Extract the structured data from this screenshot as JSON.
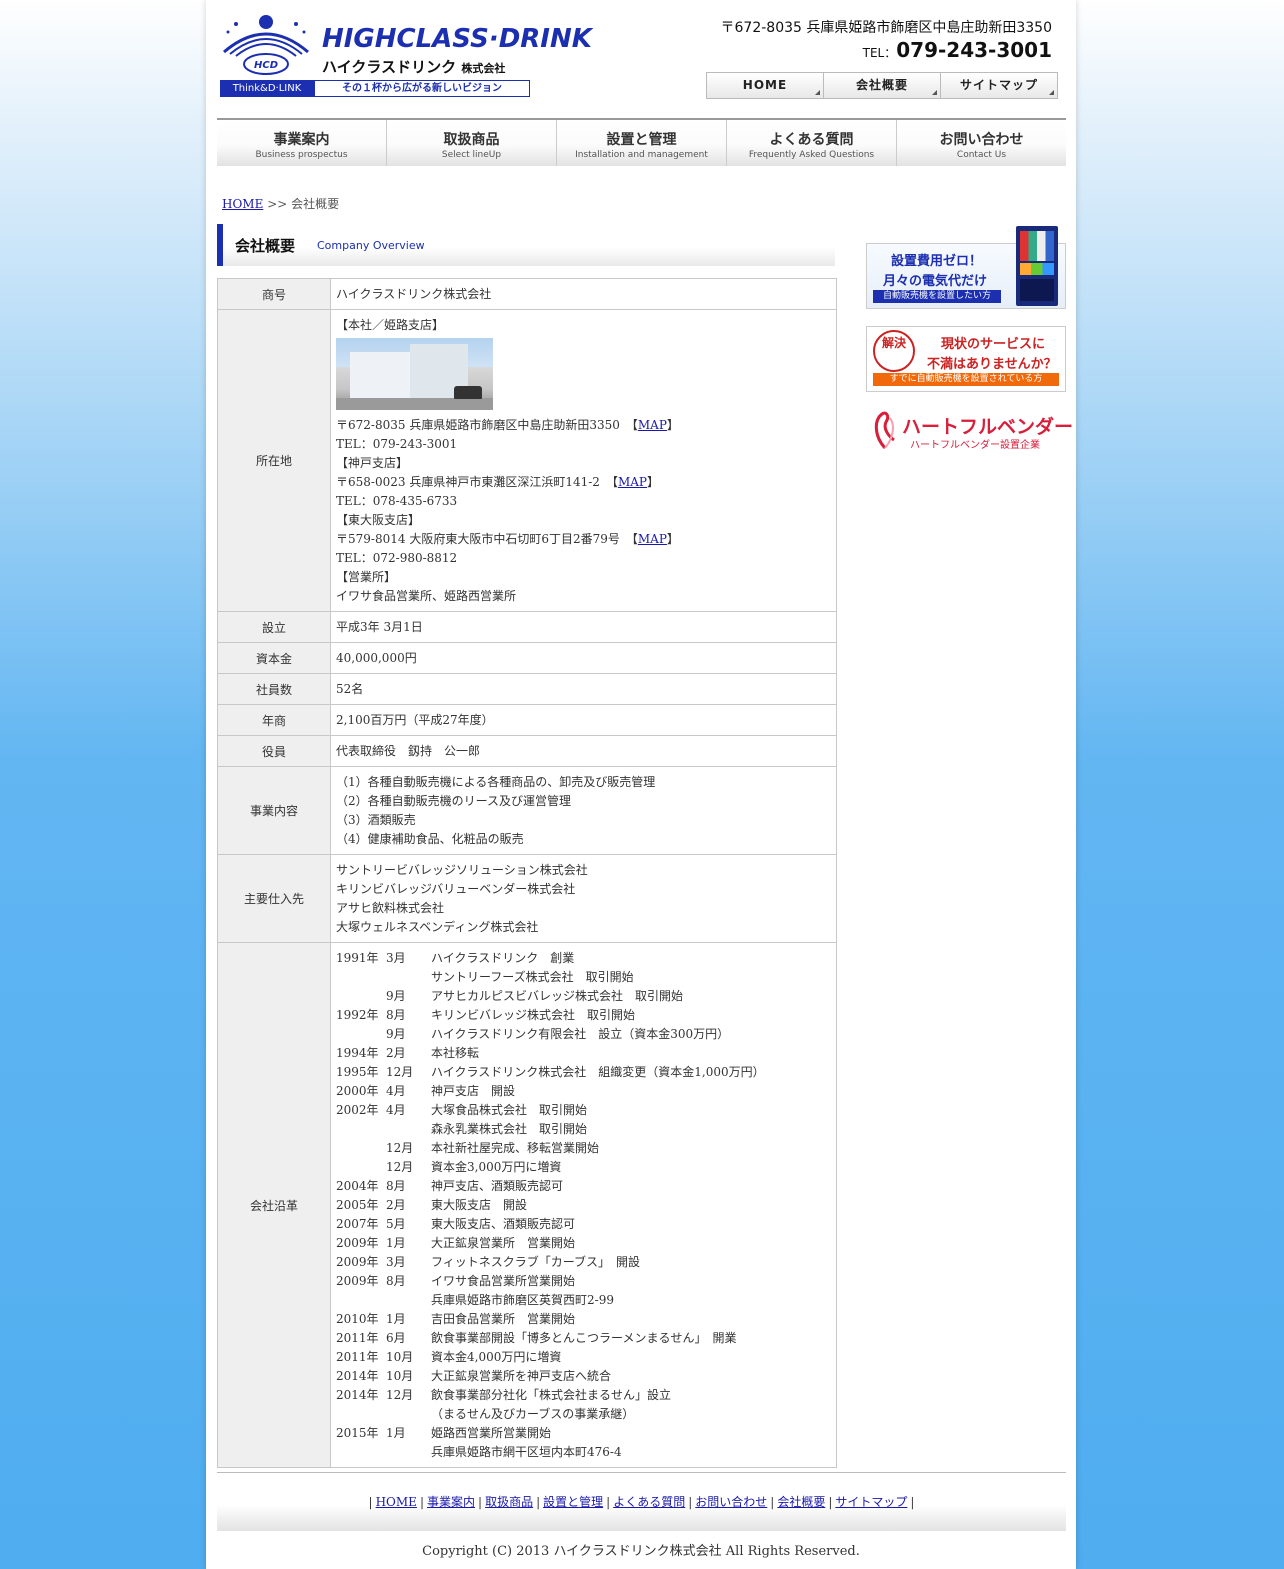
{
  "header": {
    "logo_en": "HIGHCLASS·DRINK",
    "logo_jp": "ハイクラスドリンク",
    "logo_jp_suffix": "株式会社",
    "logo_mark_text": "HCD",
    "logo_think": "Think&D·LINK",
    "logo_slogan": "その１杯から広がる新しいビジョン",
    "address": "〒672-8035 兵庫県姫路市飾磨区中島庄助新田3350",
    "tel_prefix": "TEL：",
    "tel_number": "079-243-3001"
  },
  "top_nav": [
    "HOME",
    "会社概要",
    "サイトマップ"
  ],
  "global_nav": [
    {
      "jp": "事業案内",
      "en": "Business prospectus"
    },
    {
      "jp": "取扱商品",
      "en": "Select lineUp"
    },
    {
      "jp": "設置と管理",
      "en": "Installation and management"
    },
    {
      "jp": "よくある質問",
      "en": "Frequently Asked Questions"
    },
    {
      "jp": "お問い合わせ",
      "en": "Contact Us"
    }
  ],
  "breadcrumb": {
    "home": "HOME",
    "sep": ">>",
    "current": "会社概要"
  },
  "page_title": {
    "jp": "会社概要",
    "en": "Company Overview"
  },
  "table": {
    "trade_name": {
      "label": "商号",
      "value": "ハイクラスドリンク株式会社"
    },
    "location": {
      "label": "所在地",
      "head_office_heading": "【本社／姫路支店】",
      "head_office_address": "〒672-8035 兵庫県姫路市飾磨区中島庄助新田3350",
      "head_office_tel": "TEL：079-243-3001",
      "kobe_heading": "【神戸支店】",
      "kobe_address": "〒658-0023 兵庫県神戸市東灘区深江浜町141-2",
      "kobe_tel": "TEL：078-435-6733",
      "higashiosaka_heading": "【東大阪支店】",
      "higashiosaka_address": "〒579-8014 大阪府東大阪市中石切町6丁目2番79号",
      "higashiosaka_tel": "TEL：072-980-8812",
      "sales_heading": "【営業所】",
      "sales_offices": "イワサ食品営業所、姫路西営業所",
      "map_open": "【",
      "map_label": "MAP",
      "map_close": "】"
    },
    "established": {
      "label": "設立",
      "value": "平成3年 3月1日"
    },
    "capital": {
      "label": "資本金",
      "value": "40,000,000円"
    },
    "employees": {
      "label": "社員数",
      "value": "52名"
    },
    "sales": {
      "label": "年商",
      "value": "2,100百万円（平成27年度）"
    },
    "officers": {
      "label": "役員",
      "value": "代表取締役　釼持　公一郎"
    },
    "business": {
      "label": "事業内容",
      "items": [
        "（1）各種自動販売機による各種商品の、卸売及び販売管理",
        "（2）各種自動販売機のリース及び運営管理",
        "（3）酒類販売",
        "（4）健康補助食品、化粧品の販売"
      ]
    },
    "suppliers": {
      "label": "主要仕入先",
      "items": [
        "サントリービバレッジソリューション株式会社",
        "キリンビバレッジバリューベンダー株式会社",
        "アサヒ飲料株式会社",
        "大塚ウェルネスベンディング株式会社"
      ]
    },
    "history": {
      "label": "会社沿革",
      "items": [
        {
          "y": "1991年",
          "m": "3月",
          "e": "ハイクラスドリンク　創業"
        },
        {
          "y": "",
          "m": "",
          "e": "サントリーフーズ株式会社　取引開始"
        },
        {
          "y": "",
          "m": "9月",
          "e": "アサヒカルピスビバレッジ株式会社　取引開始"
        },
        {
          "y": "1992年",
          "m": "8月",
          "e": "キリンビバレッジ株式会社　取引開始"
        },
        {
          "y": "",
          "m": "9月",
          "e": "ハイクラスドリンク有限会社　設立（資本金300万円）"
        },
        {
          "y": "1994年",
          "m": "2月",
          "e": "本社移転"
        },
        {
          "y": "1995年",
          "m": "12月",
          "e": "ハイクラスドリンク株式会社　組織変更（資本金1,000万円）"
        },
        {
          "y": "2000年",
          "m": "4月",
          "e": "神戸支店　開設"
        },
        {
          "y": "2002年",
          "m": "4月",
          "e": "大塚食品株式会社　取引開始"
        },
        {
          "y": "",
          "m": "",
          "e": "森永乳業株式会社　取引開始"
        },
        {
          "y": "",
          "m": "12月",
          "e": "本社新社屋完成、移転営業開始"
        },
        {
          "y": "",
          "m": "12月",
          "e": "資本金3,000万円に増資"
        },
        {
          "y": "2004年",
          "m": "8月",
          "e": "神戸支店、酒類販売認可"
        },
        {
          "y": "2005年",
          "m": "2月",
          "e": "東大阪支店　開設"
        },
        {
          "y": "2007年",
          "m": "5月",
          "e": "東大阪支店、酒類販売認可"
        },
        {
          "y": "2009年",
          "m": "1月",
          "e": "大正鉱泉営業所　営業開始"
        },
        {
          "y": "2009年",
          "m": "3月",
          "e": "フィットネスクラブ「カーブス」　開設"
        },
        {
          "y": "2009年",
          "m": "8月",
          "e": "イワサ食品営業所営業開始"
        },
        {
          "y": "",
          "m": "",
          "e": "兵庫県姫路市飾磨区英賀西町2-99"
        },
        {
          "y": "2010年",
          "m": "1月",
          "e": "吉田食品営業所　営業開始"
        },
        {
          "y": "2011年",
          "m": "6月",
          "e": "飲食事業部開設「博多とんこつラーメンまるせん」　開業"
        },
        {
          "y": "2011年",
          "m": "10月",
          "e": "資本金4,000万円に増資"
        },
        {
          "y": "2014年",
          "m": "10月",
          "e": "大正鉱泉営業所を神戸支店へ統合"
        },
        {
          "y": "2014年",
          "m": "12月",
          "e": "飲食事業部分社化「株式会社まるせん」設立"
        },
        {
          "y": "",
          "m": "",
          "e": "（まるせん及びカーブスの事業承継）"
        },
        {
          "y": "2015年",
          "m": "1月",
          "e": "姫路西営業所営業開始"
        },
        {
          "y": "",
          "m": "",
          "e": "兵庫県姫路市網干区垣内本町476-4"
        }
      ]
    }
  },
  "banners": {
    "b1_title": "設置費用ゼロ！",
    "b1_sub": "月々の電気代だけ",
    "b1_strip": "自動販売機を設置したい方",
    "b2_seal": "解決",
    "b2_line1": "現状のサービスに",
    "b2_line2": "不満はありませんか？",
    "b2_strip": "すでに自動販売機を設置されている方",
    "b3_title": "ハートフルベンダー",
    "b3_sub": "ハートフルベンダー設置企業"
  },
  "footer_nav": [
    "HOME",
    "事業案内",
    "取扱商品",
    "設置と管理",
    "よくある質問",
    "お問い合わせ",
    "会社概要",
    "サイトマップ"
  ],
  "footer_sep": "|",
  "copyright": "Copyright (C) 2013 ハイクラスドリンク株式会社 All Rights Reserved.",
  "colors": {
    "brand_blue": "#1b2fb0",
    "banner_red": "#d81e3a",
    "strip_orange": "#f06a0c",
    "background_blue": "#4fadf0"
  }
}
